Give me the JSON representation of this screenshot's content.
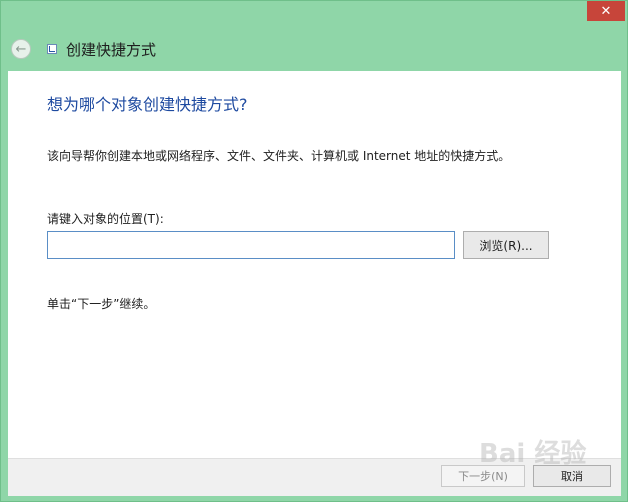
{
  "window": {
    "title": "创建快捷方式",
    "close_glyph": "✕",
    "back_icon": "back-arrow-icon",
    "shortcut_icon": "shortcut-icon"
  },
  "main": {
    "heading": "想为哪个对象创建快捷方式?",
    "description": "该向导帮你创建本地或网络程序、文件、文件夹、计算机或 Internet 地址的快捷方式。",
    "field_label": "请键入对象的位置(T):",
    "location_value": "",
    "browse_label": "浏览(R)...",
    "hint": "单击“下一步”继续。"
  },
  "footer": {
    "next_label": "下一步(N)",
    "cancel_label": "取消"
  },
  "watermark": {
    "text": "Bai 经验"
  },
  "colors": {
    "frame": "#8fd6a8",
    "heading": "#1e4aa0",
    "close": "#c7453a"
  }
}
